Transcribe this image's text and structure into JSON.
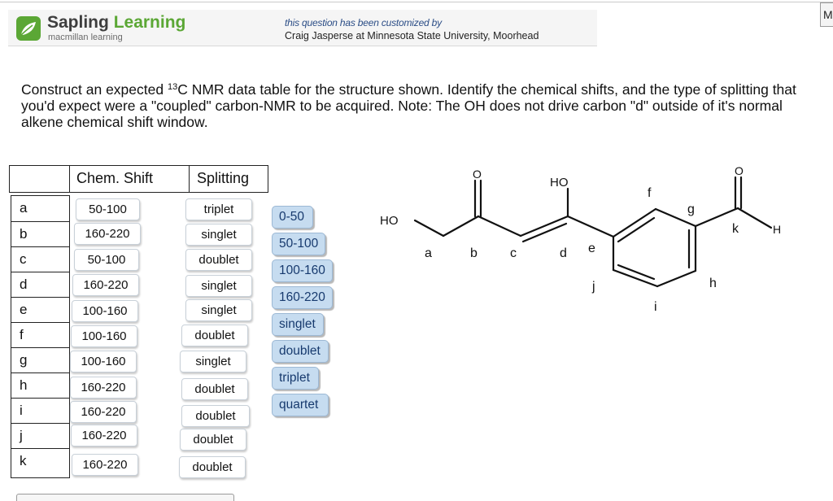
{
  "window": {
    "corner_button_label": "M"
  },
  "header": {
    "brand_part1": "Sapling",
    "brand_part2": "Learning",
    "brand_sub": "macmillan learning",
    "custom_line1": "this question has been customized by",
    "custom_line2": "Craig Jasperse at Minnesota State University, Moorhead",
    "logo_icon": "sapling-leaf-icon",
    "colors": {
      "brand_green": "#5ba735",
      "brand_grey": "#3e3e3e",
      "custom_blue": "#2b4d86"
    }
  },
  "question": {
    "before_sup": "Construct an expected ",
    "sup": "13",
    "after_sup": "C NMR data table for the structure shown.   Identify the chemical shifts, and the type of splitting that you'd expect were a \"coupled\" carbon-NMR to be acquired.  Note:  The OH does not drive carbon \"d\" outside of it's normal alkene chemical shift window."
  },
  "table": {
    "headers": {
      "chem_shift": "Chem. Shift",
      "splitting": "Splitting"
    },
    "rows": [
      {
        "label": "a",
        "shift": "50-100",
        "splitting": "triplet"
      },
      {
        "label": "b",
        "shift": "160-220",
        "splitting": "singlet"
      },
      {
        "label": "c",
        "shift": "50-100",
        "splitting": "doublet"
      },
      {
        "label": "d",
        "shift": "160-220",
        "splitting": "singlet"
      },
      {
        "label": "e",
        "shift": "100-160",
        "splitting": "singlet"
      },
      {
        "label": "f",
        "shift": "100-160",
        "splitting": "doublet"
      },
      {
        "label": "g",
        "shift": "100-160",
        "splitting": "singlet"
      },
      {
        "label": "h",
        "shift": "160-220",
        "splitting": "doublet"
      },
      {
        "label": "i",
        "shift": "160-220",
        "splitting": "doublet"
      },
      {
        "label": "j",
        "shift": "160-220",
        "splitting": "doublet"
      },
      {
        "label": "k",
        "shift": "160-220",
        "splitting": "doublet"
      }
    ]
  },
  "answer_bank": {
    "items": [
      "0-50",
      "50-100",
      "100-160",
      "160-220",
      "singlet",
      "doublet",
      "triplet",
      "quartet"
    ],
    "colors": {
      "fill": "#c6dcf0",
      "border": "#9cb8d4",
      "text": "#173a6e"
    }
  },
  "structure": {
    "atoms": {
      "ho_left": "HO",
      "ho_top": "HO",
      "o_ketone": "O",
      "o_aldehyde": "O",
      "h_aldehyde": "H"
    },
    "carbon_labels": [
      "a",
      "b",
      "c",
      "d",
      "e",
      "f",
      "g",
      "h",
      "i",
      "j",
      "k"
    ]
  }
}
